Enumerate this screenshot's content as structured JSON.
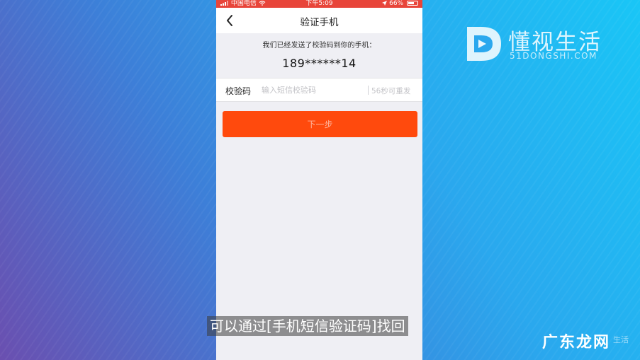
{
  "background": {
    "gradient_colors": [
      "#6a4fb0",
      "#3d7fd8",
      "#2aa8ee",
      "#19c6f6"
    ]
  },
  "watermark": {
    "title": "懂视生活",
    "subtitle": "51DONGSHI.COM",
    "icon": "d-logo-icon"
  },
  "statusbar": {
    "carrier": "中国电信",
    "time": "下午5:09",
    "battery": "66%",
    "color": "#e8453a"
  },
  "navbar": {
    "title": "验证手机",
    "back_icon": "chevron-left-icon"
  },
  "info": {
    "message": "我们已经发送了校验码到你的手机：",
    "phone_number": "189******14"
  },
  "code_row": {
    "label": "校验码",
    "placeholder": "输入短信校验码",
    "value": "",
    "resend": "56秒可重发"
  },
  "next_button": {
    "label": "下一步",
    "color": "#ff4a0d"
  },
  "subtitle": "可以通过[手机短信验证码]找回",
  "corner_watermark": {
    "text": "广东龙网",
    "small": "生活"
  }
}
